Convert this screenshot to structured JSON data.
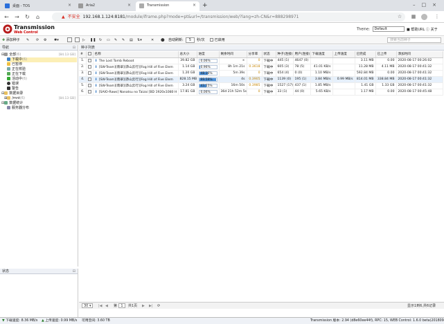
{
  "browser": {
    "tabs": [
      {
        "title": "桌面 - TOS"
      },
      {
        "title": "Aria2"
      },
      {
        "title": "Transmission"
      }
    ],
    "address": {
      "warning": "不安全",
      "host": "192.168.1.124:8181",
      "path": "/module/iframe.php?mode=pt&url=/transmission/web/?lang=zh-CN&r=888298971"
    }
  },
  "app": {
    "brand": "Transmission",
    "brand_sub": "Web Control",
    "theme_label": "Theme:",
    "theme_value": "Default",
    "link_help": "帮助URL",
    "link_about": "关于"
  },
  "toolbar": {
    "add_label": "添加种子",
    "limit_label": "自动刷新:",
    "limit_value": "5",
    "limit_unit": "秒/次",
    "enabled_label": "已启用",
    "search_placeholder": "搜索当前种子"
  },
  "navigation": {
    "title": "导航",
    "items": [
      {
        "label": "全部",
        "count": "(6)",
        "size": "[84.13 GB]"
      },
      {
        "label": "下载中",
        "count": "(6)"
      },
      {
        "label": "已暂停",
        "count": ""
      },
      {
        "label": "正在校验",
        "count": ""
      },
      {
        "label": "正在下载",
        "count": ""
      },
      {
        "label": "活动中",
        "count": "(6)"
      },
      {
        "label": "错误",
        "count": ""
      },
      {
        "label": "警告",
        "count": ""
      },
      {
        "label": "数据目录",
        "count": ""
      },
      {
        "label": "/mnt",
        "count": "(6)",
        "size": "[84.13 GB]"
      },
      {
        "label": "数据统计",
        "count": ""
      },
      {
        "label": "服务器分布",
        "count": ""
      }
    ]
  },
  "status_panel": {
    "title": "状态"
  },
  "torrents": {
    "panel_title": "种子列表",
    "columns": [
      "#",
      "",
      "名称",
      "总大小",
      "进度",
      "剩余时间",
      "分享率",
      "状态",
      "种子(连接)",
      "用户(连接)",
      "下载速度",
      "上传速度",
      "已完成",
      "已上传",
      "添加时间"
    ],
    "rows": [
      {
        "num": "1.",
        "name": "The Lost Tomb Reboot",
        "size": "39.82 GB",
        "progress": 0.0,
        "progress_text": "0.06%",
        "eta": "∞",
        "ratio": "0",
        "status": "下载中",
        "seeds": "445 (1)",
        "peers": "4647 (0)",
        "dl": "",
        "ul": "",
        "done": "3.11 MB",
        "uploaded": "0.00",
        "added": "2020-08-17 00:26:02"
      },
      {
        "num": "2.",
        "name": "[SW-Team][翡翠][莽山云行][Fog Hill of Five Elem",
        "size": "1.14 GB",
        "progress": 0.0096,
        "progress_text": "0.96%",
        "eta": "8h 1m 21s",
        "ratio": "0.3618",
        "status": "下载中",
        "seeds": "605 (3)",
        "peers": "78 (5)",
        "dl": "41.01 KB/s",
        "ul": "",
        "done": "11.28 MB",
        "uploaded": "4.11 MB",
        "added": "2020-08-17 00:41:32"
      },
      {
        "num": "3.",
        "name": "[SW-Team][翡翠][莽山云行][Fog Hill of Five Elem",
        "size": "1.20 GB",
        "progress": 0.4816,
        "progress_text": "48.16%",
        "eta": "5m 39s",
        "ratio": "0",
        "status": "下载中",
        "seeds": "654 (4)",
        "peers": "0 (0)",
        "dl": "1.10 MB/s",
        "ul": "",
        "done": "592.84 MB",
        "uploaded": "0.00",
        "added": "2020-08-17 00:41:32"
      },
      {
        "num": "4.",
        "name": "[SW-Team][翡翠][莽山云行][Fog Hill of Five Elem",
        "size": "828.15 MB",
        "progress": 0.9959,
        "progress_text": "99.59%",
        "eta": "4s",
        "ratio": "0.3905",
        "status": "下载中",
        "seeds": "1139 (0)",
        "peers": "195 (1)",
        "dl": "3.84 MB/s",
        "ul": "0.99 MB/s",
        "done": "814.01 MB",
        "uploaded": "338.84 MB",
        "added": "2020-08-17 00:41:32"
      },
      {
        "num": "5.",
        "name": "[SW-Team][翡翠][莽山云行][Fog Hill of Five Elem",
        "size": "3.24 GB",
        "progress": 0.4355,
        "progress_text": "43.55%",
        "eta": "16m 50s",
        "ratio": "0.3985",
        "status": "下载中",
        "seeds": "1527 (17)",
        "peers": "437 (1)",
        "dl": "1.85 MB/s",
        "ul": "",
        "done": "1.41 GB",
        "uploaded": "1.33 GB",
        "added": "2020-08-17 00:41:32"
      },
      {
        "num": "6.",
        "name": "[SAIO-Raws] Nanatsu no Taizai [BD 1920x1080 H",
        "size": "17.81 GB",
        "progress": 0.0006,
        "progress_text": "0.06%",
        "eta": "36d 21h 52m 5s",
        "ratio": "0",
        "status": "下载中",
        "seeds": "33 (1)",
        "peers": "44 (0)",
        "dl": "5.65 KB/s",
        "ul": "",
        "done": "1.17 MB",
        "uploaded": "0.00",
        "added": "2020-08-17 00:45:48"
      }
    ]
  },
  "pager": {
    "page_size": "30",
    "page_label": "第",
    "page_value": "1",
    "total_label": "共1页",
    "summary": "显示1到6,共6记录"
  },
  "statusbar": {
    "dl_label": "下载速度:",
    "dl_value": "8.36 MB/s",
    "ul_label": "上传速度:",
    "ul_value": "0.99 MB/s",
    "free_label": "可用空间:",
    "free_value": "3.60 TB",
    "version": "Transmission 版本: 2.94 (d8e60ee44f), RPC: 15, WEB Control: 1.6.0 beta(20180906)"
  },
  "colors": {
    "accent": "#4a90d9",
    "warning": "#d93025",
    "selected": "#fcefb6",
    "ratio": "#c58400"
  }
}
